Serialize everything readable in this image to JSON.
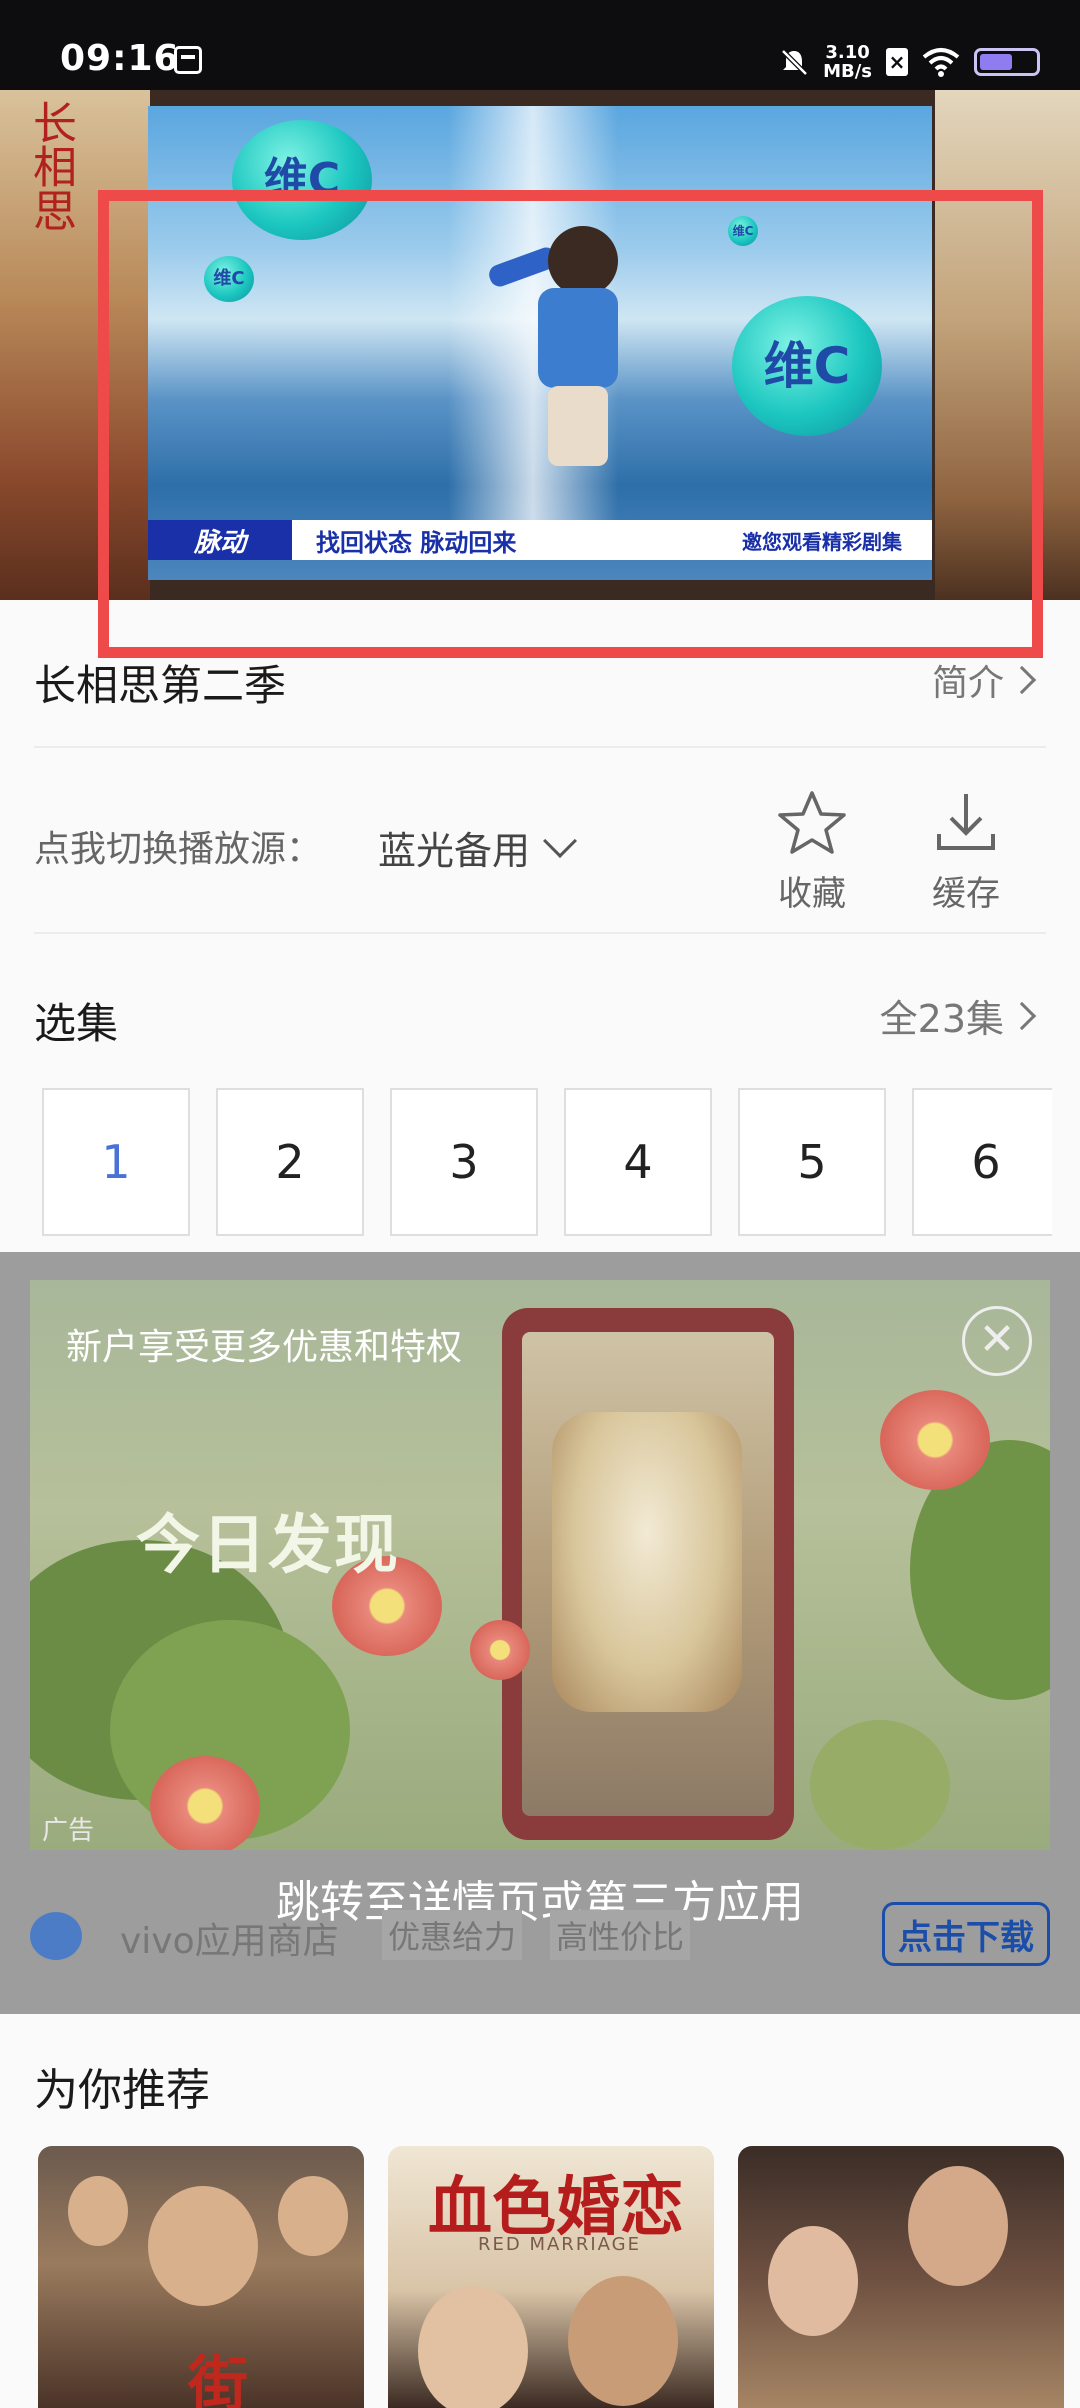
{
  "status_bar": {
    "time": "09:16",
    "net_speed_value": "3.10",
    "net_speed_unit": "MB/s",
    "battery_level": 0.6
  },
  "video": {
    "poster_title": "长相思",
    "ad": {
      "brand": "脉动",
      "ball_label": "维C",
      "slogan": "找回状态 脉动回来",
      "invite": "邀您观看精彩剧集"
    }
  },
  "show": {
    "title": "长相思第二季",
    "intro_label": "简介"
  },
  "source": {
    "label": "点我切换播放源：",
    "value": "蓝光备用"
  },
  "actions": {
    "favorite_label": "收藏",
    "download_label": "缓存"
  },
  "episodes": {
    "title": "选集",
    "all_label": "全23集",
    "items": [
      {
        "label": "1",
        "active": true
      },
      {
        "label": "2",
        "active": false
      },
      {
        "label": "3",
        "active": false
      },
      {
        "label": "4",
        "active": false
      },
      {
        "label": "5",
        "active": false
      },
      {
        "label": "6",
        "active": false
      }
    ]
  },
  "ad_overlay": {
    "subtitle": "新户享受更多优惠和特权",
    "headline": "今日发现",
    "tag": "广告",
    "jump_text": "跳转至详情页或第三方应用",
    "store_name": "vivo应用商店",
    "tags": [
      "优惠给力",
      "高性价比"
    ],
    "download_label": "点击下载",
    "close_symbol": "✕"
  },
  "recommend": {
    "title": "为你推荐",
    "items": [
      {
        "poster_text": "街"
      },
      {
        "poster_text": "血色婚恋",
        "poster_sub": "RED MARRIAGE"
      },
      {
        "poster_text": ""
      }
    ]
  },
  "colors": {
    "highlight_box": "#ef4a4a",
    "active_episode": "#4a72d6",
    "download_button": "#1b4ea8"
  }
}
